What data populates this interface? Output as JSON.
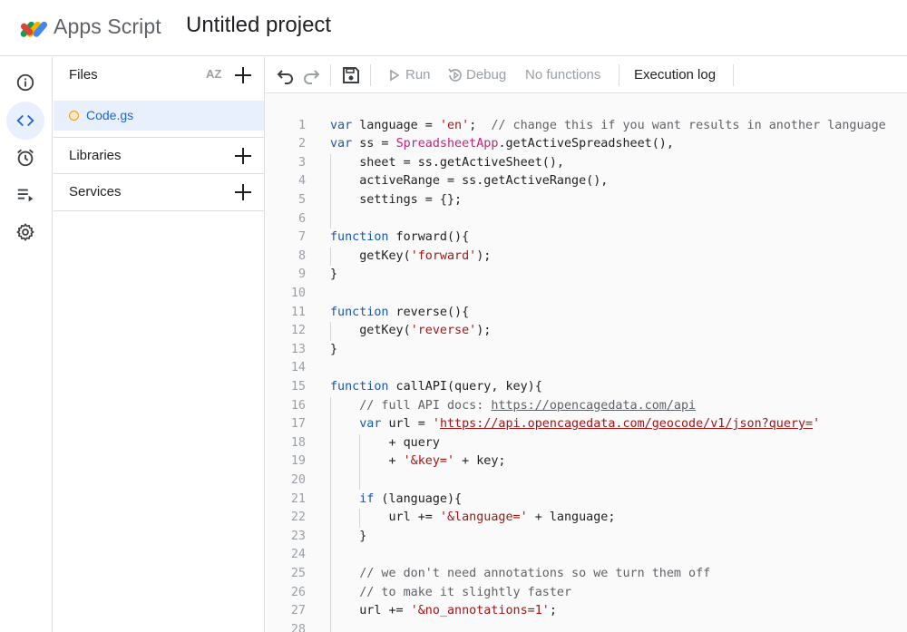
{
  "header": {
    "app_name": "Apps Script",
    "project_title": "Untitled project"
  },
  "rail": {
    "items": [
      {
        "name": "overview",
        "icon": "info-icon",
        "active": false
      },
      {
        "name": "editor",
        "icon": "code-icon",
        "active": true
      },
      {
        "name": "triggers",
        "icon": "alarm-icon",
        "active": false
      },
      {
        "name": "executions",
        "icon": "executions-icon",
        "active": false
      },
      {
        "name": "settings",
        "icon": "gear-icon",
        "active": false
      }
    ]
  },
  "files_panel": {
    "files_label": "Files",
    "sort_label": "AZ",
    "files": [
      {
        "name": "Code.gs"
      }
    ],
    "libraries_label": "Libraries",
    "services_label": "Services"
  },
  "toolbar": {
    "run_label": "Run",
    "debug_label": "Debug",
    "function_select": "No functions",
    "execution_log_label": "Execution log"
  },
  "colors": {
    "accent": "#1967d2",
    "active_bg": "#e8f0fe",
    "keyword": "#1a57b3",
    "string": "#a31515",
    "class": "#c5227f",
    "comment": "#5f6368"
  },
  "code_lines": [
    {
      "n": "1",
      "text": "var language = 'en';  // change this if you want results in another language"
    },
    {
      "n": "2",
      "text": "var ss = SpreadsheetApp.getActiveSpreadsheet(),"
    },
    {
      "n": "3",
      "text": "    sheet = ss.getActiveSheet(),"
    },
    {
      "n": "4",
      "text": "    activeRange = ss.getActiveRange(),"
    },
    {
      "n": "5",
      "text": "    settings = {};"
    },
    {
      "n": "6",
      "text": ""
    },
    {
      "n": "7",
      "text": "function forward(){"
    },
    {
      "n": "8",
      "text": "    getKey('forward');"
    },
    {
      "n": "9",
      "text": "}"
    },
    {
      "n": "10",
      "text": ""
    },
    {
      "n": "11",
      "text": "function reverse(){"
    },
    {
      "n": "12",
      "text": "    getKey('reverse');"
    },
    {
      "n": "13",
      "text": "}"
    },
    {
      "n": "14",
      "text": ""
    },
    {
      "n": "15",
      "text": "function callAPI(query, key){"
    },
    {
      "n": "16",
      "text": "    // full API docs: https://opencagedata.com/api"
    },
    {
      "n": "17",
      "text": "    var url = 'https://api.opencagedata.com/geocode/v1/json?query='"
    },
    {
      "n": "18",
      "text": "        + query"
    },
    {
      "n": "19",
      "text": "        + '&key=' + key;"
    },
    {
      "n": "20",
      "text": ""
    },
    {
      "n": "21",
      "text": "    if (language){"
    },
    {
      "n": "22",
      "text": "        url += '&language=' + language;"
    },
    {
      "n": "23",
      "text": "    }"
    },
    {
      "n": "24",
      "text": ""
    },
    {
      "n": "25",
      "text": "    // we don't need annotations so we turn them off"
    },
    {
      "n": "26",
      "text": "    // to make it slightly faster"
    },
    {
      "n": "27",
      "text": "    url += '&no_annotations=1';"
    },
    {
      "n": "28",
      "text": ""
    }
  ]
}
